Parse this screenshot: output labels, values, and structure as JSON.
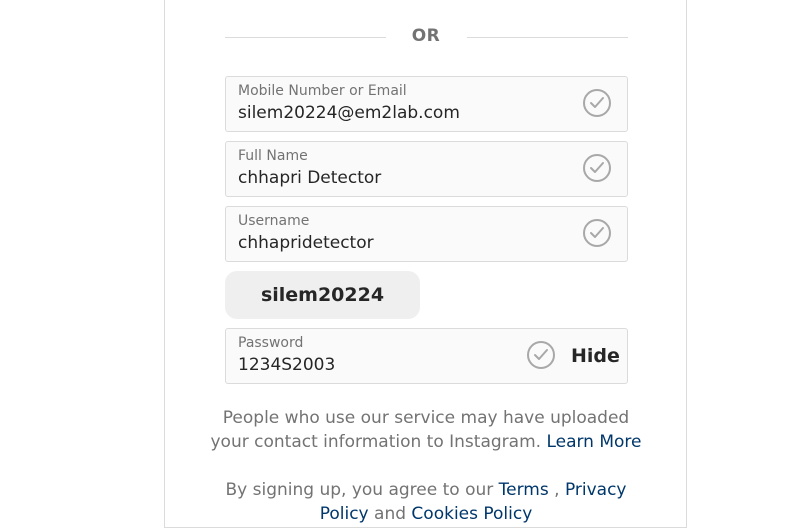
{
  "divider": {
    "text": "OR"
  },
  "fields": {
    "contact": {
      "label": "Mobile Number or Email",
      "value": "silem20224@em2lab.com",
      "icon": "check-circle-icon"
    },
    "full_name": {
      "label": "Full Name",
      "value": "chhapri Detector",
      "icon": "check-circle-icon"
    },
    "username": {
      "label": "Username",
      "value": "chhapridetector",
      "icon": "check-circle-icon"
    },
    "password": {
      "label": "Password",
      "value": "1234S2003",
      "icon": "check-circle-icon",
      "toggle_label": "Hide"
    }
  },
  "username_suggestion": "silem20224",
  "contact_info": {
    "text_line1": "People who use our service may have uploaded",
    "text_line2": "your contact information to Instagram.",
    "link": "Learn More"
  },
  "terms": {
    "prefix": "By signing up, you agree to our",
    "terms_link": "Terms",
    "separator": ",",
    "privacy_link_part1": "Privacy",
    "privacy_link_part2": "Policy",
    "and_text": "and",
    "cookies_link": "Cookies Policy"
  },
  "colors": {
    "link": "#00376b",
    "muted_text": "#737373",
    "border": "#dbdbdb",
    "field_bg": "#fafafa",
    "check_icon": "#a8a8a8"
  }
}
